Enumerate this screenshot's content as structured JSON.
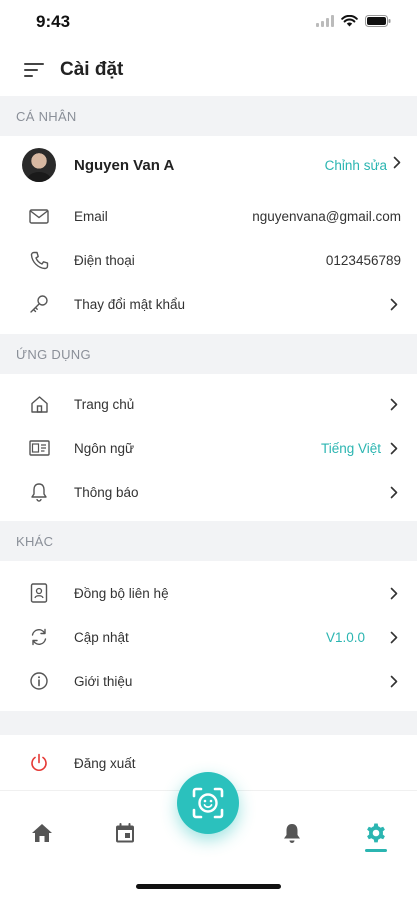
{
  "status": {
    "time": "9:43"
  },
  "header": {
    "title": "Cài đặt",
    "menu_icon": "menu-lines-icon"
  },
  "sections": {
    "personal": {
      "title": "CÁ NHÂN",
      "profile": {
        "name": "Nguyen Van A",
        "edit_label": "Chỉnh sửa"
      },
      "email": {
        "label": "Email",
        "value": "nguyenvana@gmail.com"
      },
      "phone": {
        "label": "Điện thoại",
        "value": "0123456789"
      },
      "password": {
        "label": "Thay đổi mật khẩu"
      }
    },
    "app": {
      "title": "ỨNG DỤNG",
      "home": {
        "label": "Trang chủ"
      },
      "language": {
        "label": "Ngôn ngữ",
        "value": "Tiếng Việt"
      },
      "notifications": {
        "label": "Thông báo"
      }
    },
    "other": {
      "title": "KHÁC",
      "sync": {
        "label": "Đồng bộ liên hệ"
      },
      "update": {
        "label": "Cập nhật",
        "value": "V1.0.0"
      },
      "about": {
        "label": "Giới thiệu"
      }
    },
    "logout": {
      "label": "Đăng xuất"
    }
  },
  "colors": {
    "accent": "#2bb5b1",
    "danger": "#e53935",
    "section_bg": "#f2f3f5"
  },
  "tabbar": {
    "tabs": [
      "home-icon",
      "calendar-icon",
      "face-scan-icon",
      "bell-icon",
      "gear-icon"
    ],
    "active": "gear-icon"
  }
}
